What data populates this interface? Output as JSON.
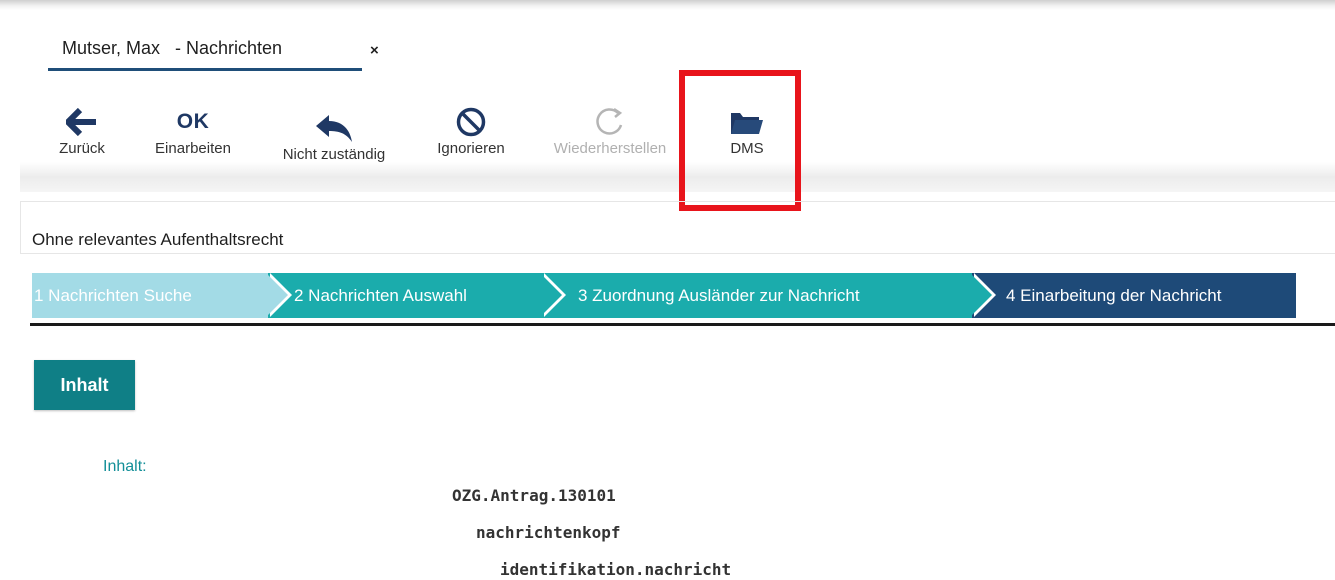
{
  "tab": {
    "title": "Mutser, Max   - Nachrichten",
    "close": "×"
  },
  "toolbar": {
    "back": "Zurück",
    "ok_text": "OK",
    "process": "Einarbeiten",
    "not_responsible": "Nicht zuständig",
    "ignore": "Ignorieren",
    "restore": "Wiederherstellen",
    "dms": "DMS"
  },
  "status": "Ohne relevantes Aufenthaltsrecht",
  "steps": [
    {
      "label": "1  Nachrichten Suche"
    },
    {
      "label": "2  Nachrichten Auswahl"
    },
    {
      "label": "3  Zuordnung Ausländer zur Nachricht"
    },
    {
      "label": "4  Einarbeitung der Nachricht"
    }
  ],
  "content": {
    "button": "Inhalt",
    "label": "Inhalt:",
    "lines": [
      "OZG.Antrag.130101",
      "nachrichtenkopf",
      "identifikation.nachricht"
    ]
  },
  "colors": {
    "dark_blue": "#1f3864",
    "teal": "#1bacac",
    "light_teal": "#a3dbe6",
    "navy": "#1e4a78",
    "highlight": "#e8141b"
  }
}
